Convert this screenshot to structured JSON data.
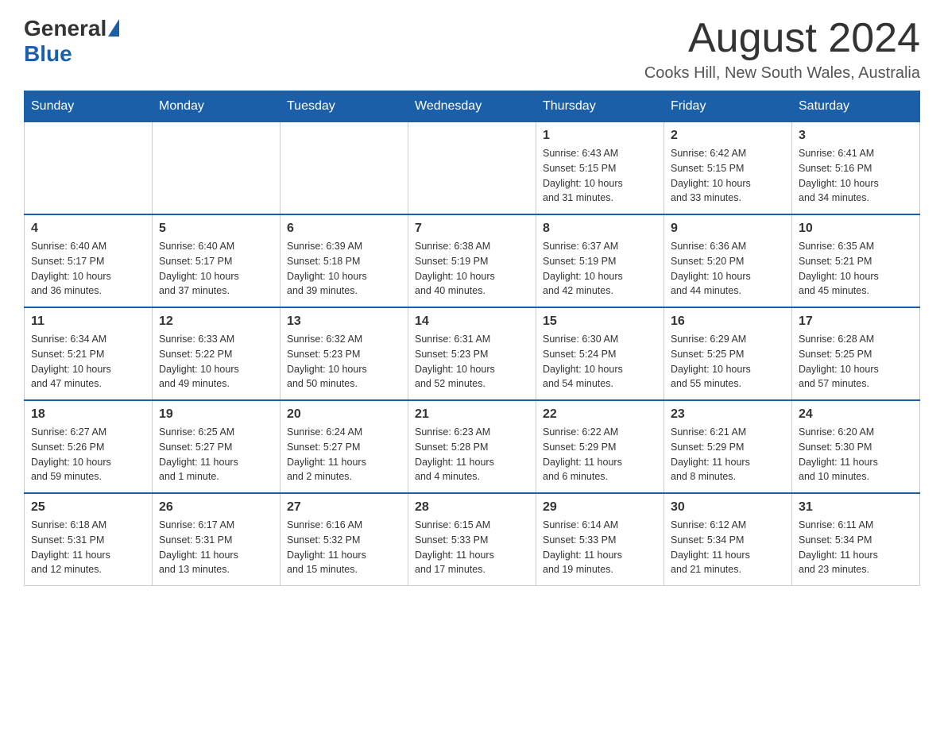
{
  "header": {
    "logo_general": "General",
    "logo_blue": "Blue",
    "month": "August 2024",
    "location": "Cooks Hill, New South Wales, Australia"
  },
  "weekdays": [
    "Sunday",
    "Monday",
    "Tuesday",
    "Wednesday",
    "Thursday",
    "Friday",
    "Saturday"
  ],
  "weeks": [
    [
      {
        "day": "",
        "info": ""
      },
      {
        "day": "",
        "info": ""
      },
      {
        "day": "",
        "info": ""
      },
      {
        "day": "",
        "info": ""
      },
      {
        "day": "1",
        "info": "Sunrise: 6:43 AM\nSunset: 5:15 PM\nDaylight: 10 hours\nand 31 minutes."
      },
      {
        "day": "2",
        "info": "Sunrise: 6:42 AM\nSunset: 5:15 PM\nDaylight: 10 hours\nand 33 minutes."
      },
      {
        "day": "3",
        "info": "Sunrise: 6:41 AM\nSunset: 5:16 PM\nDaylight: 10 hours\nand 34 minutes."
      }
    ],
    [
      {
        "day": "4",
        "info": "Sunrise: 6:40 AM\nSunset: 5:17 PM\nDaylight: 10 hours\nand 36 minutes."
      },
      {
        "day": "5",
        "info": "Sunrise: 6:40 AM\nSunset: 5:17 PM\nDaylight: 10 hours\nand 37 minutes."
      },
      {
        "day": "6",
        "info": "Sunrise: 6:39 AM\nSunset: 5:18 PM\nDaylight: 10 hours\nand 39 minutes."
      },
      {
        "day": "7",
        "info": "Sunrise: 6:38 AM\nSunset: 5:19 PM\nDaylight: 10 hours\nand 40 minutes."
      },
      {
        "day": "8",
        "info": "Sunrise: 6:37 AM\nSunset: 5:19 PM\nDaylight: 10 hours\nand 42 minutes."
      },
      {
        "day": "9",
        "info": "Sunrise: 6:36 AM\nSunset: 5:20 PM\nDaylight: 10 hours\nand 44 minutes."
      },
      {
        "day": "10",
        "info": "Sunrise: 6:35 AM\nSunset: 5:21 PM\nDaylight: 10 hours\nand 45 minutes."
      }
    ],
    [
      {
        "day": "11",
        "info": "Sunrise: 6:34 AM\nSunset: 5:21 PM\nDaylight: 10 hours\nand 47 minutes."
      },
      {
        "day": "12",
        "info": "Sunrise: 6:33 AM\nSunset: 5:22 PM\nDaylight: 10 hours\nand 49 minutes."
      },
      {
        "day": "13",
        "info": "Sunrise: 6:32 AM\nSunset: 5:23 PM\nDaylight: 10 hours\nand 50 minutes."
      },
      {
        "day": "14",
        "info": "Sunrise: 6:31 AM\nSunset: 5:23 PM\nDaylight: 10 hours\nand 52 minutes."
      },
      {
        "day": "15",
        "info": "Sunrise: 6:30 AM\nSunset: 5:24 PM\nDaylight: 10 hours\nand 54 minutes."
      },
      {
        "day": "16",
        "info": "Sunrise: 6:29 AM\nSunset: 5:25 PM\nDaylight: 10 hours\nand 55 minutes."
      },
      {
        "day": "17",
        "info": "Sunrise: 6:28 AM\nSunset: 5:25 PM\nDaylight: 10 hours\nand 57 minutes."
      }
    ],
    [
      {
        "day": "18",
        "info": "Sunrise: 6:27 AM\nSunset: 5:26 PM\nDaylight: 10 hours\nand 59 minutes."
      },
      {
        "day": "19",
        "info": "Sunrise: 6:25 AM\nSunset: 5:27 PM\nDaylight: 11 hours\nand 1 minute."
      },
      {
        "day": "20",
        "info": "Sunrise: 6:24 AM\nSunset: 5:27 PM\nDaylight: 11 hours\nand 2 minutes."
      },
      {
        "day": "21",
        "info": "Sunrise: 6:23 AM\nSunset: 5:28 PM\nDaylight: 11 hours\nand 4 minutes."
      },
      {
        "day": "22",
        "info": "Sunrise: 6:22 AM\nSunset: 5:29 PM\nDaylight: 11 hours\nand 6 minutes."
      },
      {
        "day": "23",
        "info": "Sunrise: 6:21 AM\nSunset: 5:29 PM\nDaylight: 11 hours\nand 8 minutes."
      },
      {
        "day": "24",
        "info": "Sunrise: 6:20 AM\nSunset: 5:30 PM\nDaylight: 11 hours\nand 10 minutes."
      }
    ],
    [
      {
        "day": "25",
        "info": "Sunrise: 6:18 AM\nSunset: 5:31 PM\nDaylight: 11 hours\nand 12 minutes."
      },
      {
        "day": "26",
        "info": "Sunrise: 6:17 AM\nSunset: 5:31 PM\nDaylight: 11 hours\nand 13 minutes."
      },
      {
        "day": "27",
        "info": "Sunrise: 6:16 AM\nSunset: 5:32 PM\nDaylight: 11 hours\nand 15 minutes."
      },
      {
        "day": "28",
        "info": "Sunrise: 6:15 AM\nSunset: 5:33 PM\nDaylight: 11 hours\nand 17 minutes."
      },
      {
        "day": "29",
        "info": "Sunrise: 6:14 AM\nSunset: 5:33 PM\nDaylight: 11 hours\nand 19 minutes."
      },
      {
        "day": "30",
        "info": "Sunrise: 6:12 AM\nSunset: 5:34 PM\nDaylight: 11 hours\nand 21 minutes."
      },
      {
        "day": "31",
        "info": "Sunrise: 6:11 AM\nSunset: 5:34 PM\nDaylight: 11 hours\nand 23 minutes."
      }
    ]
  ]
}
